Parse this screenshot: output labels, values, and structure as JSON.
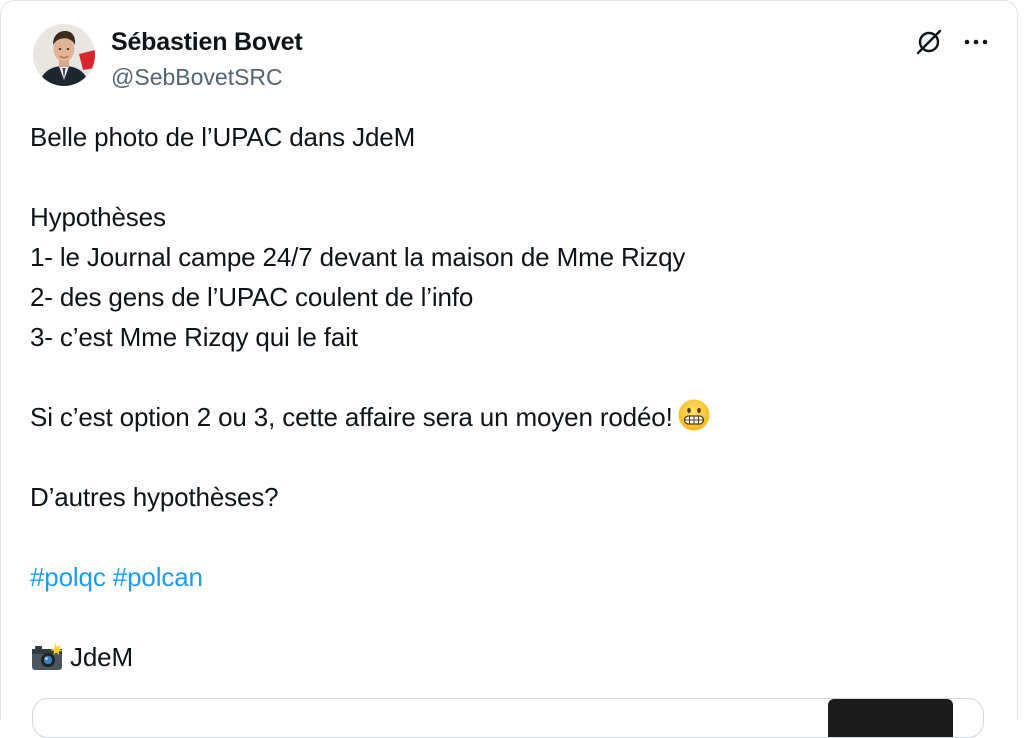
{
  "author": {
    "display_name": "Sébastien Bovet",
    "handle": "@SebBovetSRC"
  },
  "actions": {
    "grok_icon": "grok-slash-icon",
    "more_icon": "more-dots-icon"
  },
  "post": {
    "line1": "Belle photo de l’UPAC dans JdeM",
    "line2": "Hypothèses",
    "line3": "1- le Journal campe 24/7 devant la maison de Mme Rizqy",
    "line4": "2- des gens de l’UPAC coulent de l’info",
    "line5": "3- c’est Mme Rizqy qui le fait",
    "line6": "Si c’est option 2 ou 3, cette affaire sera un moyen rodéo!",
    "line7": "D’autres hypothèses?",
    "hashtags": [
      "#polqc",
      "#polcan"
    ],
    "credit": "JdeM"
  },
  "colors": {
    "text": "#0f1419",
    "secondary": "#536471",
    "link": "#1d9bf0",
    "border": "#cfd9de"
  }
}
